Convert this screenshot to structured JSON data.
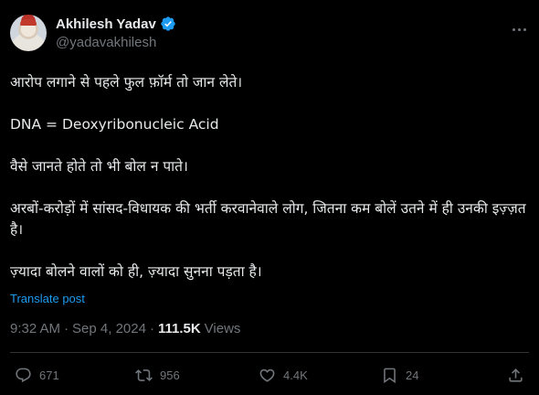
{
  "author": {
    "display_name": "Akhilesh Yadav",
    "handle": "@yadavakhilesh",
    "verified_color": "#1d9bf0"
  },
  "post": {
    "paragraphs": [
      "आरोप लगाने से पहले फुल फ़ॉर्म तो जान लेते।",
      "DNA = Deoxyribonucleic Acid",
      "वैसे जानते होते तो भी बोल न पाते।",
      "अरबों-करोड़ों में सांसद-विधायक की भर्ती करवानेवाले लोग, जितना कम बोलें उतने में ही उनकी इज़्ज़त है।",
      "ज़्यादा बोलने वालों को ही, ज़्यादा सुनना पड़ता है।"
    ],
    "translate_label": "Translate post"
  },
  "meta": {
    "time": "9:32 AM",
    "separator": "·",
    "date": "Sep 4, 2024",
    "views_count": "111.5K",
    "views_label": "Views"
  },
  "actions": {
    "replies": "671",
    "reposts": "956",
    "likes": "4.4K",
    "bookmarks": "24"
  },
  "icons": [
    "verified-badge-icon",
    "more-icon",
    "reply-icon",
    "repost-icon",
    "like-icon",
    "bookmark-icon",
    "share-icon"
  ]
}
